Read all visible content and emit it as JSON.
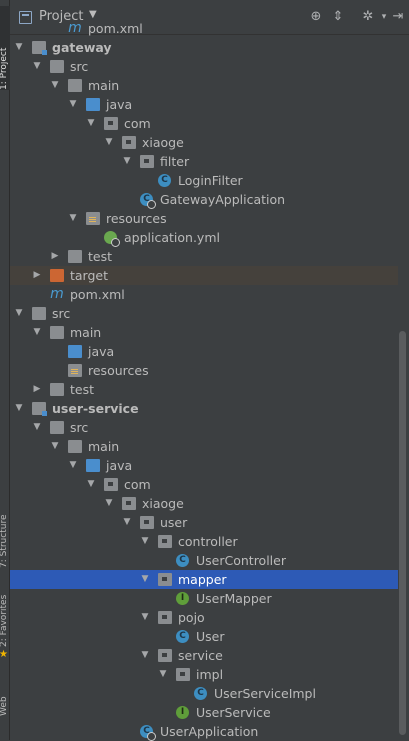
{
  "panel": {
    "title": "Project",
    "colors": {
      "background": "#3c3f41",
      "selection": "#2d5ab6"
    }
  },
  "side_tabs": [
    "1: Project",
    "7: Structure",
    "2: Favorites",
    "Web"
  ],
  "tree": [
    {
      "label": "pom.xml",
      "icon": "maven-icon",
      "depth": 3,
      "arrow": ""
    },
    {
      "label": "gateway",
      "icon": "module-folder-icon",
      "depth": 1,
      "arrow": "down",
      "bold": true
    },
    {
      "label": "src",
      "icon": "folder-icon",
      "depth": 2,
      "arrow": "down"
    },
    {
      "label": "main",
      "icon": "folder-icon",
      "depth": 3,
      "arrow": "down"
    },
    {
      "label": "java",
      "icon": "source-folder-icon",
      "depth": 4,
      "arrow": "down"
    },
    {
      "label": "com",
      "icon": "package-icon",
      "depth": 5,
      "arrow": "down"
    },
    {
      "label": "xiaoge",
      "icon": "package-icon",
      "depth": 6,
      "arrow": "down"
    },
    {
      "label": "filter",
      "icon": "package-icon",
      "depth": 7,
      "arrow": "down"
    },
    {
      "label": "LoginFilter",
      "icon": "class-icon",
      "depth": 8,
      "arrow": ""
    },
    {
      "label": "GatewayApplication",
      "icon": "spring-app-class-icon",
      "depth": 7,
      "arrow": ""
    },
    {
      "label": "resources",
      "icon": "resources-folder-icon",
      "depth": 4,
      "arrow": "down"
    },
    {
      "label": "application.yml",
      "icon": "yml-icon",
      "depth": 5,
      "arrow": ""
    },
    {
      "label": "test",
      "icon": "folder-icon",
      "depth": 3,
      "arrow": "right"
    },
    {
      "label": "target",
      "icon": "excluded-folder-icon",
      "depth": 2,
      "arrow": "right",
      "excluded": true
    },
    {
      "label": "pom.xml",
      "icon": "maven-icon",
      "depth": 2,
      "arrow": ""
    },
    {
      "label": "src",
      "icon": "folder-icon",
      "depth": 1,
      "arrow": "down"
    },
    {
      "label": "main",
      "icon": "folder-icon",
      "depth": 2,
      "arrow": "down"
    },
    {
      "label": "java",
      "icon": "source-folder-icon",
      "depth": 3,
      "arrow": ""
    },
    {
      "label": "resources",
      "icon": "resources-folder-icon",
      "depth": 3,
      "arrow": ""
    },
    {
      "label": "test",
      "icon": "folder-icon",
      "depth": 2,
      "arrow": "right"
    },
    {
      "label": "user-service",
      "icon": "module-folder-icon",
      "depth": 1,
      "arrow": "down",
      "bold": true
    },
    {
      "label": "src",
      "icon": "folder-icon",
      "depth": 2,
      "arrow": "down"
    },
    {
      "label": "main",
      "icon": "folder-icon",
      "depth": 3,
      "arrow": "down"
    },
    {
      "label": "java",
      "icon": "source-folder-icon",
      "depth": 4,
      "arrow": "down"
    },
    {
      "label": "com",
      "icon": "package-icon",
      "depth": 5,
      "arrow": "down"
    },
    {
      "label": "xiaoge",
      "icon": "package-icon",
      "depth": 6,
      "arrow": "down"
    },
    {
      "label": "user",
      "icon": "package-icon",
      "depth": 7,
      "arrow": "down"
    },
    {
      "label": "controller",
      "icon": "package-icon",
      "depth": 8,
      "arrow": "down"
    },
    {
      "label": "UserController",
      "icon": "class-icon",
      "depth": 9,
      "arrow": ""
    },
    {
      "label": "mapper",
      "icon": "package-icon",
      "depth": 8,
      "arrow": "down",
      "selected": true
    },
    {
      "label": "UserMapper",
      "icon": "interface-icon",
      "depth": 9,
      "arrow": ""
    },
    {
      "label": "pojo",
      "icon": "package-icon",
      "depth": 8,
      "arrow": "down"
    },
    {
      "label": "User",
      "icon": "class-icon",
      "depth": 9,
      "arrow": ""
    },
    {
      "label": "service",
      "icon": "package-icon",
      "depth": 8,
      "arrow": "down"
    },
    {
      "label": "impl",
      "icon": "package-icon",
      "depth": 9,
      "arrow": "down"
    },
    {
      "label": "UserServiceImpl",
      "icon": "class-icon",
      "depth": 10,
      "arrow": ""
    },
    {
      "label": "UserService",
      "icon": "interface-icon",
      "depth": 9,
      "arrow": ""
    },
    {
      "label": "UserApplication",
      "icon": "spring-app-class-icon",
      "depth": 7,
      "arrow": ""
    }
  ]
}
